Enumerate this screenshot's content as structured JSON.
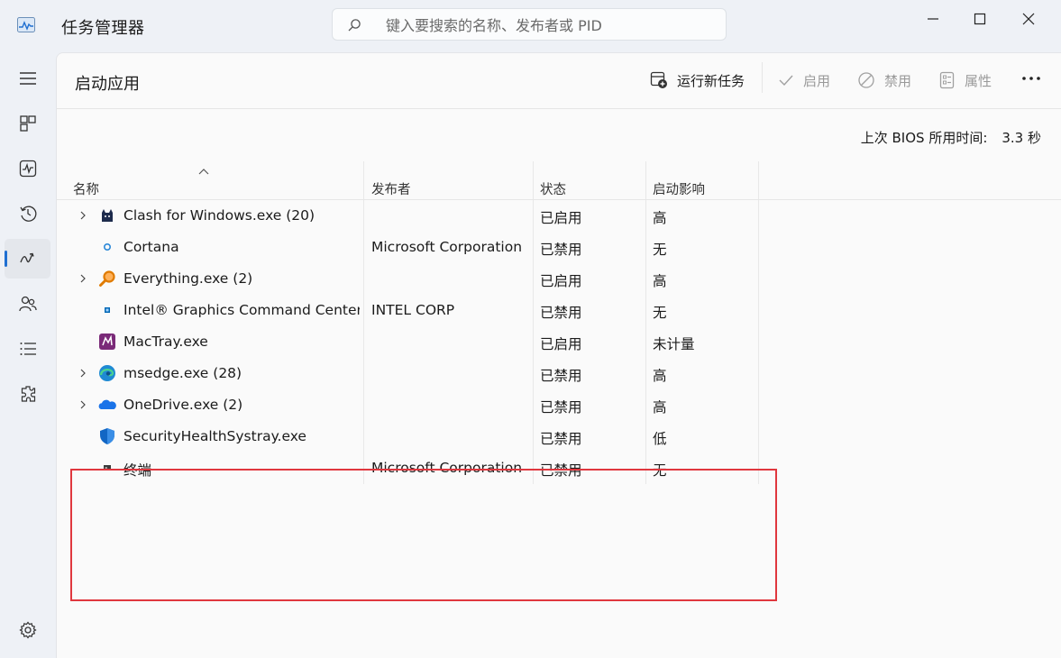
{
  "window": {
    "title": "任务管理器",
    "search_placeholder": "键入要搜索的名称、发布者或 PID"
  },
  "nav": {
    "items": [
      {
        "id": "menu",
        "icon": "hamburger-icon"
      },
      {
        "id": "processes",
        "icon": "processes-icon"
      },
      {
        "id": "performance",
        "icon": "performance-icon"
      },
      {
        "id": "app-history",
        "icon": "history-icon"
      },
      {
        "id": "startup-apps",
        "icon": "startup-icon",
        "active": true
      },
      {
        "id": "users",
        "icon": "users-icon"
      },
      {
        "id": "details",
        "icon": "details-icon"
      },
      {
        "id": "services",
        "icon": "services-icon"
      },
      {
        "id": "settings",
        "icon": "gear-icon"
      }
    ]
  },
  "page": {
    "title": "启动应用",
    "commands": {
      "run_new_task": "运行新任务",
      "enable": "启用",
      "disable": "禁用",
      "properties": "属性"
    },
    "bios": {
      "label": "上次 BIOS 所用时间:",
      "value": "3.3 秒"
    }
  },
  "table": {
    "headers": {
      "name": "名称",
      "publisher": "发布者",
      "status": "状态",
      "impact": "启动影响"
    },
    "rows": [
      {
        "name": "Clash for Windows.exe (20)",
        "publisher": "",
        "status": "已启用",
        "impact": "高",
        "expandable": true,
        "icon": "clash-cat-icon"
      },
      {
        "name": "Cortana",
        "publisher": "Microsoft Corporation",
        "status": "已禁用",
        "impact": "无",
        "expandable": false,
        "icon": "cortana-icon"
      },
      {
        "name": "Everything.exe (2)",
        "publisher": "",
        "status": "已启用",
        "impact": "高",
        "expandable": true,
        "icon": "everything-magnifier-icon"
      },
      {
        "name": "Intel® Graphics Command Center...",
        "publisher": "INTEL CORP",
        "status": "已禁用",
        "impact": "无",
        "expandable": false,
        "icon": "intel-graphics-icon"
      },
      {
        "name": "MacTray.exe",
        "publisher": "",
        "status": "已启用",
        "impact": "未计量",
        "expandable": false,
        "icon": "mactray-icon"
      },
      {
        "name": "msedge.exe (28)",
        "publisher": "",
        "status": "已禁用",
        "impact": "高",
        "expandable": true,
        "icon": "edge-icon"
      },
      {
        "name": "OneDrive.exe (2)",
        "publisher": "",
        "status": "已禁用",
        "impact": "高",
        "expandable": true,
        "icon": "onedrive-cloud-icon"
      },
      {
        "name": "SecurityHealthSystray.exe",
        "publisher": "",
        "status": "已禁用",
        "impact": "低",
        "expandable": false,
        "icon": "security-shield-icon"
      },
      {
        "name": "终端",
        "publisher": "Microsoft Corporation",
        "status": "已禁用",
        "impact": "无",
        "expandable": false,
        "icon": "terminal-icon"
      }
    ]
  },
  "colors": {
    "accent": "#1f6fd1",
    "highlight_box": "#e0373e"
  }
}
